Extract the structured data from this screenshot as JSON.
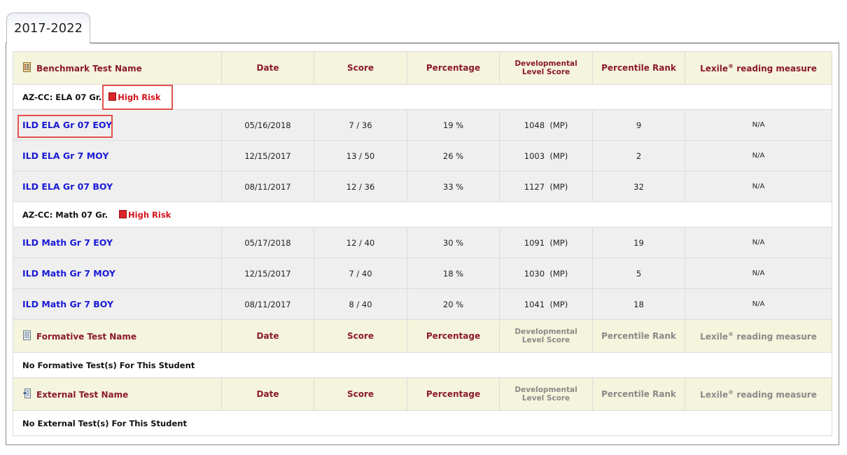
{
  "tab": {
    "label": "2017-2022"
  },
  "columns": {
    "benchmark_name": "Benchmark Test Name",
    "formative_name": "Formative Test Name",
    "external_name": "External Test Name",
    "date": "Date",
    "score": "Score",
    "percentage": "Percentage",
    "dev_level_1": "Developmental",
    "dev_level_2": "Level Score",
    "percentile": "Percentile Rank",
    "lexile_pre": "Lexile",
    "lexile_sup": "®",
    "lexile_post": " reading measure"
  },
  "groups": [
    {
      "name": "AZ-CC: ELA 07 Gr.",
      "risk": "High Risk",
      "rows": [
        {
          "test": "ILD ELA Gr 07 EOY",
          "date": "05/16/2018",
          "score": "7 / 36",
          "percentage": "19 %",
          "dev": "1048  (MP)",
          "percentile": "9",
          "lexile": "N/A"
        },
        {
          "test": "ILD ELA Gr 7 MOY",
          "date": "12/15/2017",
          "score": "13 / 50",
          "percentage": "26 %",
          "dev": "1003  (MP)",
          "percentile": "2",
          "lexile": "N/A"
        },
        {
          "test": "ILD ELA Gr 07 BOY",
          "date": "08/11/2017",
          "score": "12 / 36",
          "percentage": "33 %",
          "dev": "1127  (MP)",
          "percentile": "32",
          "lexile": "N/A"
        }
      ]
    },
    {
      "name": "AZ-CC: Math 07 Gr.",
      "risk": "High Risk",
      "rows": [
        {
          "test": "ILD Math Gr 7 EOY",
          "date": "05/17/2018",
          "score": "12 / 40",
          "percentage": "30 %",
          "dev": "1091  (MP)",
          "percentile": "19",
          "lexile": "N/A"
        },
        {
          "test": "ILD Math Gr 7 MOY",
          "date": "12/15/2017",
          "score": "7 / 40",
          "percentage": "18 %",
          "dev": "1030  (MP)",
          "percentile": "5",
          "lexile": "N/A"
        },
        {
          "test": "ILD Math Gr 7 BOY",
          "date": "08/11/2017",
          "score": "8 / 40",
          "percentage": "20 %",
          "dev": "1041  (MP)",
          "percentile": "18",
          "lexile": "N/A"
        }
      ]
    }
  ],
  "messages": {
    "no_formative": "No Formative Test(s) For This Student",
    "no_external": "No External Test(s) For This Student"
  },
  "icons": {
    "benchmark": "benchmark-list-icon",
    "formative": "formative-list-icon",
    "external": "external-import-icon",
    "risk": "high-risk-flag-icon"
  },
  "colors": {
    "header_bg": "#f5f4dc",
    "header_text": "#8b1a2c",
    "link": "#1a1ad6",
    "risk": "#d4121b",
    "row_bg": "#efefef",
    "highlight": "#e2524a"
  }
}
